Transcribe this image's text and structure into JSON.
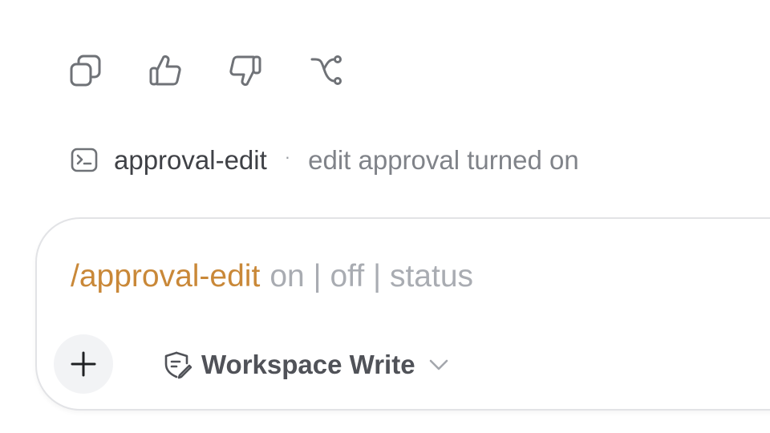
{
  "message_actions": {
    "icons": [
      "copy-icon",
      "thumbs-up-icon",
      "thumbs-down-icon",
      "branch-icon"
    ]
  },
  "command_status": {
    "icon": "terminal-icon",
    "name": "approval-edit",
    "separator": "·",
    "description": "edit approval turned on"
  },
  "composer": {
    "command": "/approval-edit",
    "args": "on | off | status",
    "add_icon": "plus-icon",
    "mode": {
      "icon": "shield-edit-icon",
      "label": "Workspace Write",
      "chevron": "chevron-down-icon"
    }
  },
  "colors": {
    "command_accent": "#c98838",
    "icon_gray": "#6f7277",
    "placeholder_gray": "#a9acb2"
  }
}
